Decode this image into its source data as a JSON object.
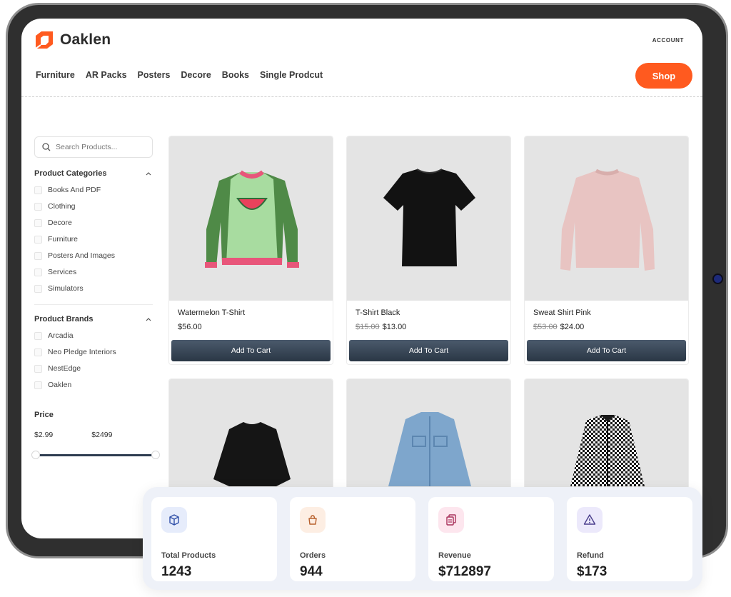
{
  "brand": {
    "name": "Oaklen",
    "accent": "#ff5a1f"
  },
  "header": {
    "account_label": "ACCOUNT",
    "nav": [
      "Furniture",
      "AR Packs",
      "Posters",
      "Decore",
      "Books",
      "Single Prodcut"
    ],
    "shop_label": "Shop"
  },
  "sidebar": {
    "search_placeholder": "Search Products...",
    "categories_title": "Product Categories",
    "categories": [
      "Books And PDF",
      "Clothing",
      "Decore",
      "Furniture",
      "Posters And Images",
      "Services",
      "Simulators"
    ],
    "brands_title": "Product Brands",
    "brands": [
      "Arcadia",
      "Neo Pledge Interiors",
      "NestEdge",
      "Oaklen"
    ],
    "price_title": "Price",
    "price_min": "$2.99",
    "price_max": "$2499"
  },
  "products": [
    {
      "name": "Watermelon T-Shirt",
      "old_price": "",
      "price": "$56.00",
      "button": "Add To Cart"
    },
    {
      "name": "T-Shirt Black",
      "old_price": "$15.00",
      "price": "$13.00",
      "button": "Add To Cart"
    },
    {
      "name": "Sweat Shirt Pink",
      "old_price": "$53.00",
      "price": "$24.00",
      "button": "Add To Cart"
    }
  ],
  "stats": [
    {
      "label": "Total Products",
      "value": "1243",
      "icon": "box-icon",
      "bg": "#e6ecfb",
      "color": "#2f4fa8"
    },
    {
      "label": "Orders",
      "value": "944",
      "icon": "bag-icon",
      "bg": "#fdeee3",
      "color": "#b8602c"
    },
    {
      "label": "Revenue",
      "value": "$712897",
      "icon": "document-icon",
      "bg": "#fde6ee",
      "color": "#a8305a"
    },
    {
      "label": "Refund",
      "value": "$173",
      "icon": "warning-icon",
      "bg": "#ece9fb",
      "color": "#4a3e8c"
    }
  ]
}
